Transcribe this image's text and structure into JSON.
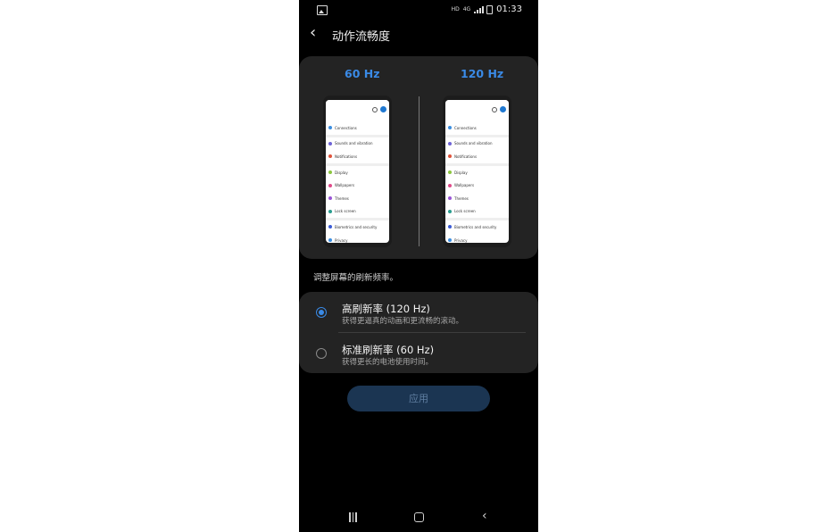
{
  "status_bar": {
    "left_icon": "gallery-notification-icon",
    "hd": "HD",
    "network": "4G",
    "time": "01:33"
  },
  "header": {
    "title": "动作流畅度",
    "back_icon": "back-arrow-icon"
  },
  "preview": {
    "left_label": "60 Hz",
    "right_label": "120 Hz",
    "settings_items": [
      {
        "label": "Connections",
        "color": "#3c8ee0"
      },
      {
        "label": "Sounds and vibration",
        "color": "#6e63d6"
      },
      {
        "label": "Notifications",
        "color": "#e0533c"
      },
      {
        "label": "Display",
        "color": "#8cc63f"
      },
      {
        "label": "Wallpapers",
        "color": "#e04a8a"
      },
      {
        "label": "Themes",
        "color": "#9a55d6"
      },
      {
        "label": "Lock screen",
        "color": "#2a9d8f"
      },
      {
        "label": "Biometrics and security",
        "color": "#3b5bd6"
      },
      {
        "label": "Privacy",
        "color": "#3c8ee0"
      }
    ]
  },
  "description": "调整屏幕的刷新频率。",
  "options": [
    {
      "title": "高刷新率 (120 Hz)",
      "subtitle": "获得更逼真的动画和更流畅的滚动。",
      "selected": true
    },
    {
      "title": "标准刷新率 (60 Hz)",
      "subtitle": "获得更长的电池使用时间。",
      "selected": false
    }
  ],
  "apply_label": "应用",
  "colors": {
    "accent": "#3a8ae6",
    "card": "#232323",
    "background": "#000000"
  }
}
